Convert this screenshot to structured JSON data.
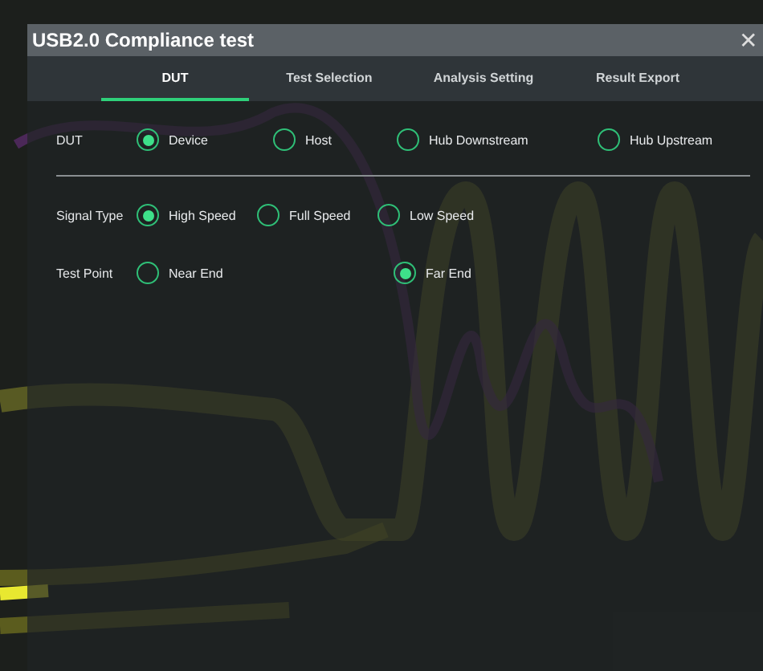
{
  "window": {
    "title": "USB2.0 Compliance test",
    "close": "✕"
  },
  "tabs": [
    {
      "label": "DUT",
      "selected": true
    },
    {
      "label": "Test Selection",
      "selected": false
    },
    {
      "label": "Analysis Setting",
      "selected": false
    },
    {
      "label": "Result Export",
      "selected": false
    }
  ],
  "rows": [
    {
      "label": "DUT",
      "options": [
        {
          "label": "Device",
          "selected": true
        },
        {
          "label": "Host",
          "selected": false
        },
        {
          "label": "Hub Downstream",
          "selected": false
        },
        {
          "label": "Hub Upstream",
          "selected": false
        }
      ]
    },
    {
      "label": "Signal Type",
      "options": [
        {
          "label": "High Speed",
          "selected": true
        },
        {
          "label": "Full Speed",
          "selected": false
        },
        {
          "label": "Low Speed",
          "selected": false
        }
      ]
    },
    {
      "label": "Test Point",
      "options": [
        {
          "label": "Near End",
          "selected": false
        },
        {
          "label": "Far End",
          "selected": true
        }
      ]
    }
  ]
}
